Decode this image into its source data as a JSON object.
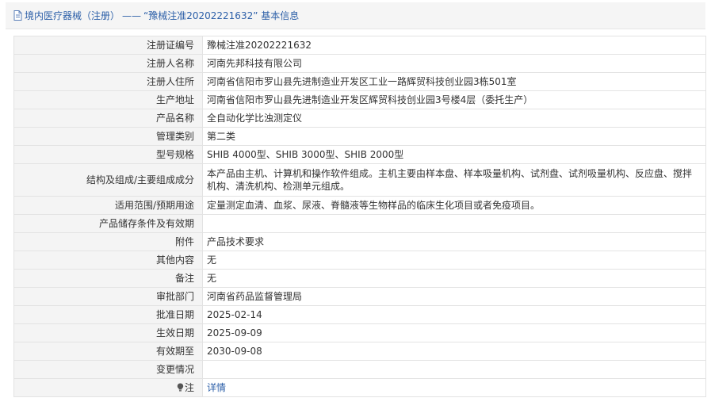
{
  "header": {
    "crumb": "境内医疗器械（注册）",
    "separator": "——",
    "title": "“豫械注准20202221632” 基本信息"
  },
  "rows": [
    {
      "label": "注册证编号",
      "value": "豫械注准20202221632"
    },
    {
      "label": "注册人名称",
      "value": "河南先邦科技有限公司"
    },
    {
      "label": "注册人住所",
      "value": "河南省信阳市罗山县先进制造业开发区工业一路辉贸科技创业园3栋501室"
    },
    {
      "label": "生产地址",
      "value": "河南省信阳市罗山县先进制造业开发区辉贸科技创业园3号楼4层（委托生产）"
    },
    {
      "label": "产品名称",
      "value": "全自动化学比浊测定仪"
    },
    {
      "label": "管理类别",
      "value": "第二类"
    },
    {
      "label": "型号规格",
      "value": "SHIB 4000型、SHIB 3000型、SHIB 2000型"
    },
    {
      "label": "结构及组成/主要组成成分",
      "value": "本产品由主机、计算机和操作软件组成。主机主要由样本盘、样本吸量机构、试剂盘、试剂吸量机构、反应盘、搅拌机构、清洗机构、检测单元组成。"
    },
    {
      "label": "适用范围/预期用途",
      "value": "定量测定血清、血浆、尿液、脊髓液等生物样品的临床生化项目或者免疫项目。"
    },
    {
      "label": "产品储存条件及有效期",
      "value": ""
    },
    {
      "label": "附件",
      "value": "产品技术要求"
    },
    {
      "label": "其他内容",
      "value": "无"
    },
    {
      "label": "备注",
      "value": "无"
    },
    {
      "label": "审批部门",
      "value": "河南省药品监督管理局"
    },
    {
      "label": "批准日期",
      "value": "2025-02-14"
    },
    {
      "label": "生效日期",
      "value": "2025-09-09"
    },
    {
      "label": "有效期至",
      "value": "2030-09-08"
    },
    {
      "label": "变更情况",
      "value": ""
    }
  ],
  "note_row": {
    "label": "注",
    "link": "详情",
    "icon": "note-icon"
  },
  "colors": {
    "link": "#2c5fa8",
    "label_bg": "#f4f4f4",
    "border": "#e3e3e3"
  }
}
